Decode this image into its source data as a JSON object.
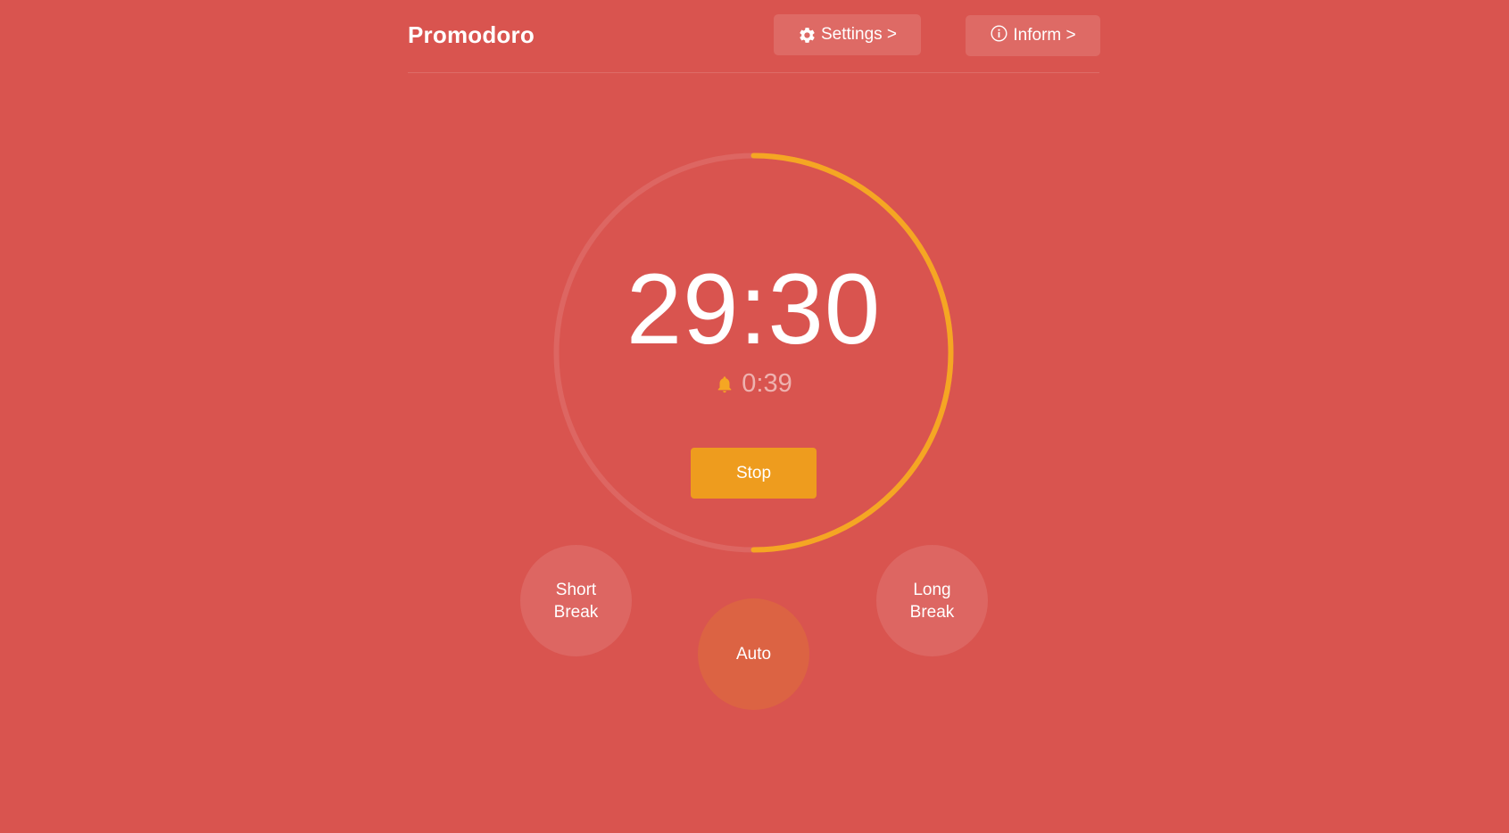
{
  "header": {
    "title": "Promodoro",
    "settings_label": "Settings >",
    "inform_label": "Inform >"
  },
  "timer": {
    "time": "29:30",
    "alarm_time": "0:39",
    "progress_fraction": 0.5,
    "stop_label": "Stop"
  },
  "modes": {
    "short_break": [
      "Short",
      "Break"
    ],
    "auto": "Auto",
    "long_break": [
      "Long",
      "Break"
    ]
  },
  "colors": {
    "background": "#d9544f",
    "accent": "#f5a623",
    "stop_button": "#ee9c1e",
    "auto_button": "#dc6343"
  },
  "icons": {
    "settings": "gear-icon",
    "inform": "info-circle-icon",
    "alarm": "bell-icon"
  }
}
